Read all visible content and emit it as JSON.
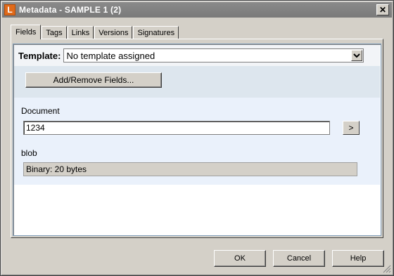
{
  "window": {
    "title": "Metadata - SAMPLE 1 (2)",
    "icon_letter": "L",
    "brand_color": "#e06a1a"
  },
  "tabs": [
    {
      "label": "Fields",
      "active": true
    },
    {
      "label": "Tags",
      "active": false
    },
    {
      "label": "Links",
      "active": false
    },
    {
      "label": "Versions",
      "active": false
    },
    {
      "label": "Signatures",
      "active": false
    }
  ],
  "template": {
    "label": "Template:",
    "selected": "No template assigned"
  },
  "fields_bar": {
    "add_remove_label": "Add/Remove Fields..."
  },
  "fields": {
    "document": {
      "label": "Document",
      "value": "1234",
      "go_label": ">"
    },
    "blob": {
      "label": "blob",
      "value": "Binary: 20 bytes"
    }
  },
  "buttons": {
    "ok": "OK",
    "cancel": "Cancel",
    "help": "Help"
  }
}
